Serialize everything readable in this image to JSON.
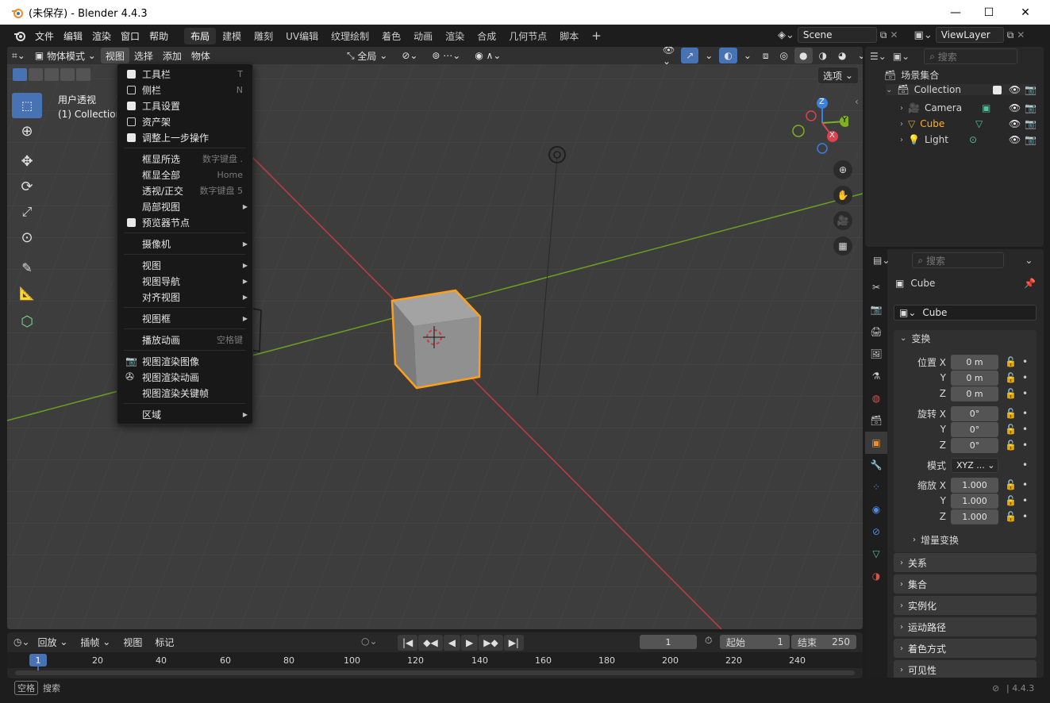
{
  "window": {
    "title": "(未保存) - Blender 4.4.3",
    "minimize": "—",
    "maximize": "☐",
    "close": "✕"
  },
  "menubar": {
    "items": [
      "文件",
      "编辑",
      "渲染",
      "窗口",
      "帮助"
    ]
  },
  "workspaces": {
    "tabs": [
      "布局",
      "建模",
      "雕刻",
      "UV编辑",
      "纹理绘制",
      "着色",
      "动画",
      "渲染",
      "合成",
      "几何节点",
      "脚本"
    ],
    "active_index": 0,
    "add": "+"
  },
  "scene": {
    "name": "Scene"
  },
  "view_layer": {
    "name": "ViewLayer"
  },
  "viewport_header": {
    "mode": "物体模式",
    "menus": [
      "视图",
      "选择",
      "添加",
      "物体"
    ],
    "transform_orientation": "全局",
    "options": "选项"
  },
  "viewport_overlay": {
    "view_name": "用户透视",
    "collection_info": "(1) Collection"
  },
  "gizmo": {
    "x": "X",
    "y": "Y",
    "z": "Z"
  },
  "view_menu": {
    "items": [
      {
        "label": "工具栏",
        "shortcut": "T",
        "check": true
      },
      {
        "label": "侧栏",
        "shortcut": "N",
        "check": false
      },
      {
        "label": "工具设置",
        "shortcut": "",
        "check": true
      },
      {
        "label": "资产架",
        "shortcut": "",
        "check": false
      },
      {
        "label": "调整上一步操作",
        "shortcut": "",
        "check": true
      },
      {
        "label": "框显所选",
        "shortcut": "数字键盘 .",
        "check": null
      },
      {
        "label": "框显全部",
        "shortcut": "Home",
        "check": null
      },
      {
        "label": "透视/正交",
        "shortcut": "数字键盘 5",
        "check": null
      },
      {
        "label": "局部视图",
        "shortcut": "",
        "check": null,
        "submenu": true
      },
      {
        "label": "预览器节点",
        "shortcut": "",
        "check": true
      },
      {
        "label": "摄像机",
        "shortcut": "",
        "check": null,
        "submenu": true
      },
      {
        "label": "视图",
        "shortcut": "",
        "check": null,
        "submenu": true
      },
      {
        "label": "视图导航",
        "shortcut": "",
        "check": null,
        "submenu": true
      },
      {
        "label": "对齐视图",
        "shortcut": "",
        "check": null,
        "submenu": true
      },
      {
        "label": "视图框",
        "shortcut": "",
        "check": null,
        "submenu": true
      },
      {
        "label": "播放动画",
        "shortcut": "空格键",
        "check": null
      },
      {
        "label": "视图渲染图像",
        "shortcut": "",
        "check": null,
        "icon": "render-image-icon"
      },
      {
        "label": "视图渲染动画",
        "shortcut": "",
        "check": null,
        "icon": "render-animation-icon"
      },
      {
        "label": "视图渲染关键帧",
        "shortcut": "",
        "check": null
      },
      {
        "label": "区域",
        "shortcut": "",
        "check": null,
        "submenu": true
      }
    ]
  },
  "outliner": {
    "search_placeholder": "搜索",
    "root": "场景集合",
    "collection": "Collection",
    "objects": [
      {
        "name": "Camera",
        "color": "#e6e6e6"
      },
      {
        "name": "Cube",
        "color": "#ffaf29"
      },
      {
        "name": "Light",
        "color": "#e6e6e6"
      }
    ]
  },
  "properties": {
    "search_placeholder": "搜索",
    "object_name": "Cube",
    "object_field": "Cube",
    "transform_title": "变换",
    "location_label": "位置 X",
    "location": [
      "0 m",
      "0 m",
      "0 m"
    ],
    "rotation_label": "旋转 X",
    "rotation": [
      "0°",
      "0°",
      "0°"
    ],
    "mode_label": "模式",
    "mode_value": "XYZ ...",
    "scale_label": "缩放 X",
    "scale": [
      "1.000",
      "1.000",
      "1.000"
    ],
    "axis_y": "Y",
    "axis_z": "Z",
    "delta_transform": "增量变换",
    "panels": [
      "关系",
      "集合",
      "实例化",
      "运动路径",
      "着色方式",
      "可见性"
    ]
  },
  "timeline": {
    "menus": [
      "回放",
      "插帧",
      "视图",
      "标记"
    ],
    "current_frame": "1",
    "start_label": "起始",
    "start": "1",
    "end_label": "结束",
    "end": "250",
    "ruler": [
      "20",
      "40",
      "60",
      "80",
      "100",
      "120",
      "140",
      "160",
      "180",
      "200",
      "220",
      "240"
    ],
    "playhead": "1"
  },
  "statusbar": {
    "key": "空格",
    "action": "搜索",
    "version": "4.4.3"
  },
  "colors": {
    "accent": "#4772b3",
    "selected_orange": "#ffaf29",
    "bg": "#1d1d1d",
    "x_axis": "#c63b3b",
    "y_axis": "#6b9f22"
  }
}
